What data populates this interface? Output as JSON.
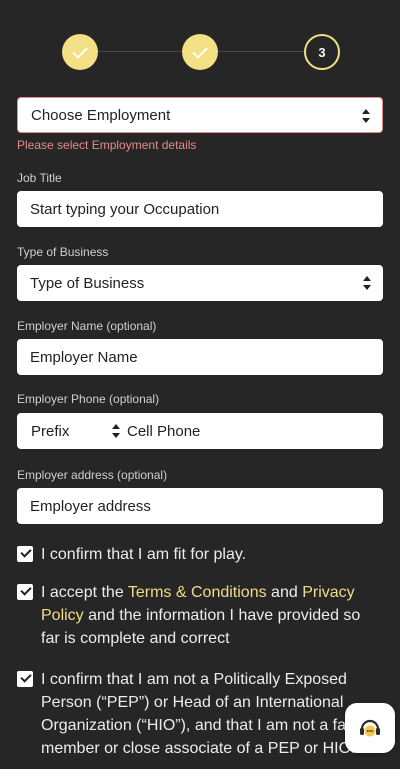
{
  "stepper": {
    "steps": [
      {
        "state": "done"
      },
      {
        "state": "done"
      },
      {
        "state": "current",
        "number": "3"
      }
    ],
    "accent_color": "#f3df84"
  },
  "form": {
    "employment": {
      "value": "Choose Employment",
      "error": "Please select Employment details"
    },
    "job_title": {
      "label": "Job Title",
      "placeholder": "Start typing your Occupation"
    },
    "business_type": {
      "label": "Type of Business",
      "value": "Type of Business"
    },
    "employer_name": {
      "label": "Employer Name (optional)",
      "placeholder": "Employer Name"
    },
    "employer_phone": {
      "label": "Employer Phone (optional)",
      "prefix": "Prefix",
      "placeholder": "Cell Phone"
    },
    "employer_address": {
      "label": "Employer address (optional)",
      "placeholder": "Employer address"
    }
  },
  "consents": [
    {
      "checked": true,
      "text": "I confirm that I am fit for play."
    },
    {
      "checked": true,
      "text_before": "I accept the ",
      "terms_link": "Terms & Conditions",
      "text_mid": " and ",
      "privacy_link": "Privacy Policy",
      "text_after": " and the information I have provided so far is complete and correct"
    },
    {
      "checked": true,
      "text": "I confirm that I am not a Politically Exposed Person (“PEP”) or Head of an International Organization (“HIO”), and that I am not a family member or close associate of a PEP or HIO."
    }
  ],
  "support": {
    "icon": "headset-chat-icon"
  }
}
